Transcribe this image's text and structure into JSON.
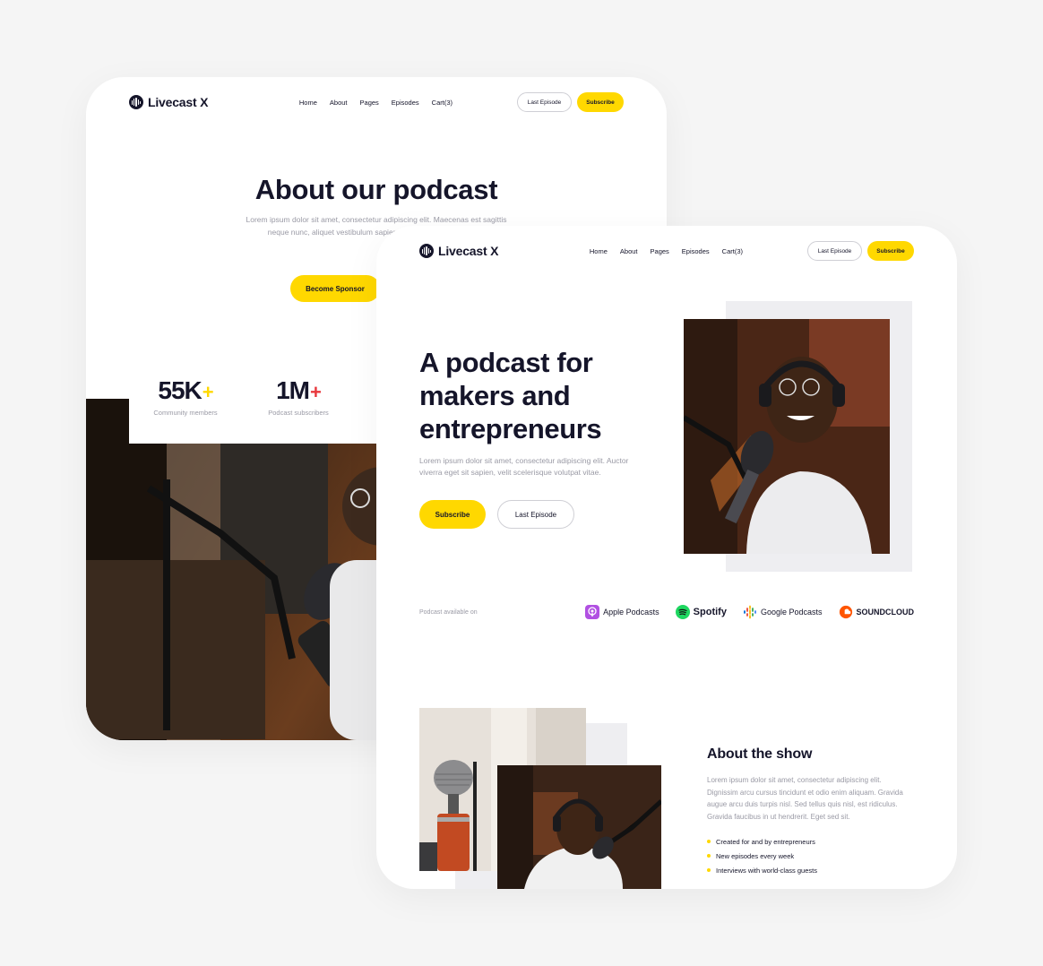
{
  "brand": {
    "name": "Livecast X"
  },
  "nav": {
    "items": [
      "Home",
      "About",
      "Pages",
      "Episodes",
      "Cart(3)"
    ],
    "last_episode": "Last Episode",
    "subscribe": "Subscribe"
  },
  "about_page": {
    "title": "About our podcast",
    "text": "Lorem ipsum dolor sit amet, consectetur adipiscing elit. Maecenas est sagittis neque nunc, aliquet vestibulum sapien est interdum massa proin",
    "cta": "Become Sponsor",
    "stats": [
      {
        "value": "55K",
        "plus": "+",
        "plus_color": "#ffd800",
        "label": "Community members"
      },
      {
        "value": "1M",
        "plus": "+",
        "plus_color": "#e8383d",
        "label": "Podcast subscribers"
      }
    ]
  },
  "home_page": {
    "hero": {
      "title": "A podcast for makers and entrepreneurs",
      "text": "Lorem ipsum dolor sit amet, consectetur adipiscing elit. Auctor viverra eget sit sapien, velit scelerisque volutpat vitae.",
      "subscribe": "Subscribe",
      "last_episode": "Last Episode"
    },
    "availability": {
      "label": "Podcast available on",
      "platforms": [
        {
          "name": "Apple Podcasts",
          "icon": "apple-podcasts-icon",
          "color": "#b150e2"
        },
        {
          "name": "Spotify",
          "icon": "spotify-icon",
          "color": "#1ed760"
        },
        {
          "name": "Google Podcasts",
          "icon": "google-podcasts-icon",
          "color": "#4285f4"
        },
        {
          "name": "SOUNDCLOUD",
          "icon": "soundcloud-icon",
          "color": "#ff5500"
        }
      ]
    },
    "about_show": {
      "title": "About the show",
      "text": "Lorem ipsum dolor sit amet, consectetur adipiscing elit. Dignissim arcu cursus tincidunt et odio enim aliquam. Gravida augue arcu duis turpis nisl. Sed tellus quis nisl, est ridiculus. Gravida faucibus in ut hendrerit. Eget sed sit.",
      "bullets": [
        "Created for and by entrepreneurs",
        "New episodes every week",
        "Interviews with world-class guests"
      ]
    }
  },
  "colors": {
    "accent": "#ffd800",
    "text": "#15152a",
    "muted": "#9a9aa5"
  }
}
